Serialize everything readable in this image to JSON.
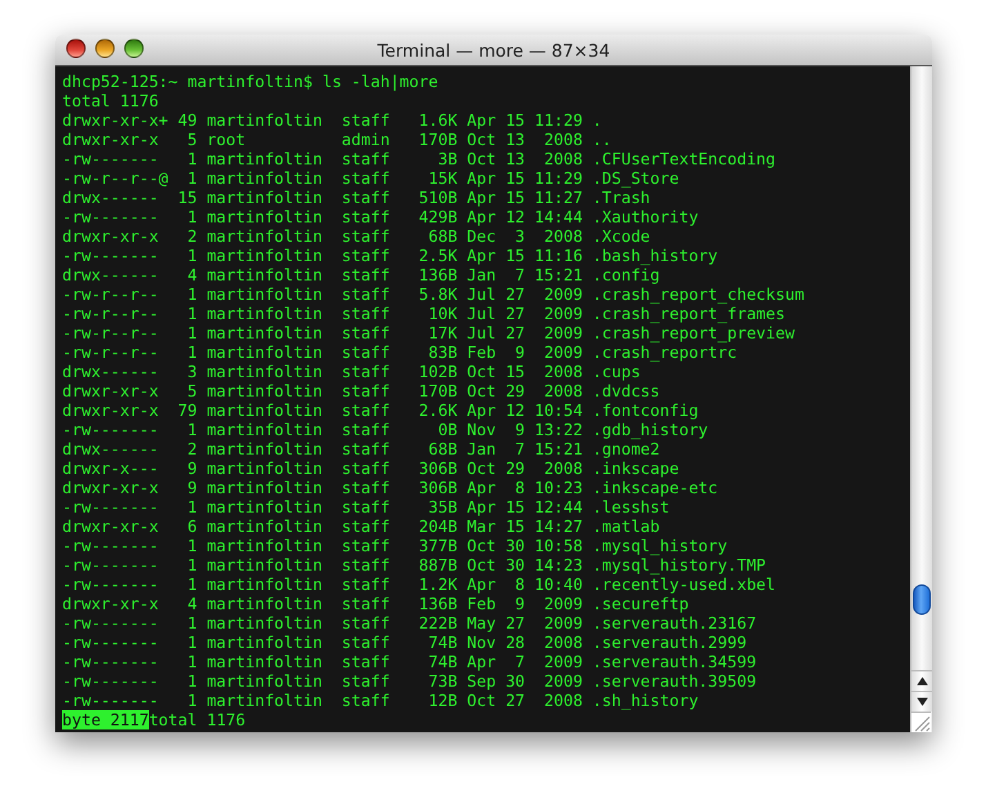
{
  "window": {
    "title": "Terminal — more — 87×34"
  },
  "lines": [
    "dhcp52-125:~ martinfoltin$ ls -lah|more",
    "total 1176",
    "drwxr-xr-x+ 49 martinfoltin  staff   1.6K Apr 15 11:29 .",
    "drwxr-xr-x   5 root          admin   170B Oct 13  2008 ..",
    "-rw-------   1 martinfoltin  staff     3B Oct 13  2008 .CFUserTextEncoding",
    "-rw-r--r--@  1 martinfoltin  staff    15K Apr 15 11:29 .DS_Store",
    "drwx------  15 martinfoltin  staff   510B Apr 15 11:27 .Trash",
    "-rw-------   1 martinfoltin  staff   429B Apr 12 14:44 .Xauthority",
    "drwxr-xr-x   2 martinfoltin  staff    68B Dec  3  2008 .Xcode",
    "-rw-------   1 martinfoltin  staff   2.5K Apr 15 11:16 .bash_history",
    "drwx------   4 martinfoltin  staff   136B Jan  7 15:21 .config",
    "-rw-r--r--   1 martinfoltin  staff   5.8K Jul 27  2009 .crash_report_checksum",
    "-rw-r--r--   1 martinfoltin  staff    10K Jul 27  2009 .crash_report_frames",
    "-rw-r--r--   1 martinfoltin  staff    17K Jul 27  2009 .crash_report_preview",
    "-rw-r--r--   1 martinfoltin  staff    83B Feb  9  2009 .crash_reportrc",
    "drwx------   3 martinfoltin  staff   102B Oct 15  2008 .cups",
    "drwxr-xr-x   5 martinfoltin  staff   170B Oct 29  2008 .dvdcss",
    "drwxr-xr-x  79 martinfoltin  staff   2.6K Apr 12 10:54 .fontconfig",
    "-rw-------   1 martinfoltin  staff     0B Nov  9 13:22 .gdb_history",
    "drwx------   2 martinfoltin  staff    68B Jan  7 15:21 .gnome2",
    "drwxr-x---   9 martinfoltin  staff   306B Oct 29  2008 .inkscape",
    "drwxr-xr-x   9 martinfoltin  staff   306B Apr  8 10:23 .inkscape-etc",
    "-rw-------   1 martinfoltin  staff    35B Apr 15 12:44 .lesshst",
    "drwxr-xr-x   6 martinfoltin  staff   204B Mar 15 14:27 .matlab",
    "-rw-------   1 martinfoltin  staff   377B Oct 30 10:58 .mysql_history",
    "-rw-------   1 martinfoltin  staff   887B Oct 30 14:23 .mysql_history.TMP",
    "-rw-------   1 martinfoltin  staff   1.2K Apr  8 10:40 .recently-used.xbel",
    "drwxr-xr-x   4 martinfoltin  staff   136B Feb  9  2009 .secureftp",
    "-rw-------   1 martinfoltin  staff   222B May 27  2009 .serverauth.23167",
    "-rw-------   1 martinfoltin  staff    74B Nov 28  2008 .serverauth.2999",
    "-rw-------   1 martinfoltin  staff    74B Apr  7  2009 .serverauth.34599",
    "-rw-------   1 martinfoltin  staff    73B Sep 30  2009 .serverauth.39509",
    "-rw-------   1 martinfoltin  staff    12B Oct 27  2008 .sh_history"
  ],
  "pager": {
    "highlight": "byte 2117",
    "text": "total 1176"
  }
}
